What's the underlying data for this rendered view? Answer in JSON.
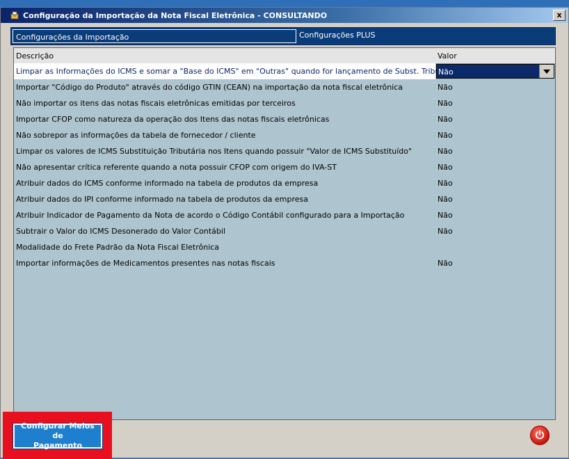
{
  "window": {
    "title": "Configuração da Importação da Nota Fiscal Eletrônica   -   CONSULTANDO",
    "close_label": "x"
  },
  "tabs": [
    {
      "label": "Configurações da Importação",
      "active": true
    },
    {
      "label": "Configurações PLUS",
      "active": false
    }
  ],
  "grid": {
    "columns": {
      "description": "Descrição",
      "value": "Valor"
    },
    "rows": [
      {
        "description": "Limpar as Informações do ICMS e somar a \"Base do ICMS\" em \"Outras\" quando for lançamento de Subst. Tributária",
        "value": "Não"
      },
      {
        "description": "Importar \"Código do Produto\" através do código GTIN (CEAN) na importação da nota fiscal eletrônica",
        "value": "Não"
      },
      {
        "description": "Não importar os itens das notas fiscais eletrônicas emitidas por terceiros",
        "value": "Não"
      },
      {
        "description": "Importar CFOP como natureza da operação dos Itens das notas fiscais eletrônicas",
        "value": "Não"
      },
      {
        "description": "Não sobrepor as informações da tabela de fornecedor / cliente",
        "value": "Não"
      },
      {
        "description": "Limpar os valores de ICMS Substituição Tributária nos Itens quando possuir \"Valor de ICMS Substituído\"",
        "value": "Não"
      },
      {
        "description": "Não apresentar crítica referente quando a nota possuir CFOP com origem do IVA-ST",
        "value": "Não"
      },
      {
        "description": "Atribuir dados do ICMS conforme informado na tabela de produtos da empresa",
        "value": "Não"
      },
      {
        "description": "Atribuir dados do IPI conforme informado na tabela de produtos da empresa",
        "value": "Não"
      },
      {
        "description": "Atribuir Indicador de Pagamento da Nota de acordo o Código Contábil configurado para a Importação",
        "value": "Não"
      },
      {
        "description": "Subtrair o Valor do ICMS Desonerado do Valor Contábil",
        "value": "Não"
      },
      {
        "description": "Modalidade do Frete Padrão da Nota Fiscal Eletrônica",
        "value": ""
      },
      {
        "description": "Importar informações de Medicamentos presentes nas notas fiscais",
        "value": "Não"
      }
    ]
  },
  "footer": {
    "pay_button_line1": "Configurar Meios de",
    "pay_button_line2": "Pagamento"
  },
  "icons": {
    "title": "app-icon",
    "dropdown": "chevron-down-icon",
    "power": "power-icon"
  }
}
